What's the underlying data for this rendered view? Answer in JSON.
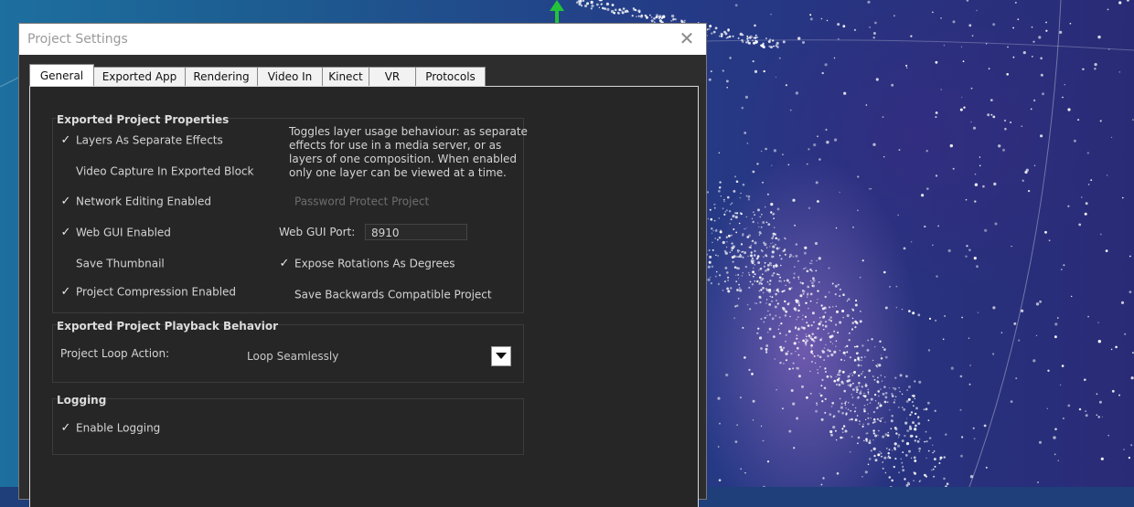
{
  "window": {
    "title": "Project Settings",
    "close_icon": "close-icon"
  },
  "tabs": [
    {
      "label": "General",
      "active": true
    },
    {
      "label": "Exported App",
      "active": false
    },
    {
      "label": "Rendering",
      "active": false
    },
    {
      "label": "Video In",
      "active": false
    },
    {
      "label": "Kinect",
      "active": false
    },
    {
      "label": "VR",
      "active": false
    },
    {
      "label": "Protocols",
      "active": false
    }
  ],
  "exported_project_properties": {
    "title": "Exported Project Properties",
    "description": "Toggles layer usage behaviour: as separate effects for use in a media server, or as layers of one composition. When enabled only one layer can be viewed at a time.",
    "options": {
      "layers_as_separate_effects": {
        "label": "Layers As Separate Effects",
        "checked": true
      },
      "video_capture_in_exported_block": {
        "label": "Video Capture In Exported Block",
        "checked": false
      },
      "network_editing_enabled": {
        "label": "Network Editing Enabled",
        "checked": true
      },
      "password_protect_project": {
        "label": "Password Protect Project",
        "checked": false,
        "disabled": true
      },
      "web_gui_enabled": {
        "label": "Web GUI Enabled",
        "checked": true
      },
      "save_thumbnail": {
        "label": "Save Thumbnail",
        "checked": false
      },
      "expose_rotations_as_degrees": {
        "label": "Expose Rotations As Degrees",
        "checked": true
      },
      "project_compression_enabled": {
        "label": "Project Compression Enabled",
        "checked": true
      },
      "save_backwards_compatible_project": {
        "label": "Save Backwards Compatible Project",
        "checked": false
      }
    },
    "web_gui_port": {
      "label": "Web GUI Port:",
      "value": "8910"
    }
  },
  "playback_behavior": {
    "title": "Exported Project Playback Behavior",
    "loop_action_label": "Project Loop Action:",
    "loop_action_value": "Loop Seamlessly"
  },
  "logging": {
    "title": "Logging",
    "enable_logging": {
      "label": "Enable Logging",
      "checked": true
    }
  },
  "colors": {
    "dialog_bg": "#2d2d2d",
    "panel_bg": "#262626",
    "text": "#d4d4d4"
  }
}
